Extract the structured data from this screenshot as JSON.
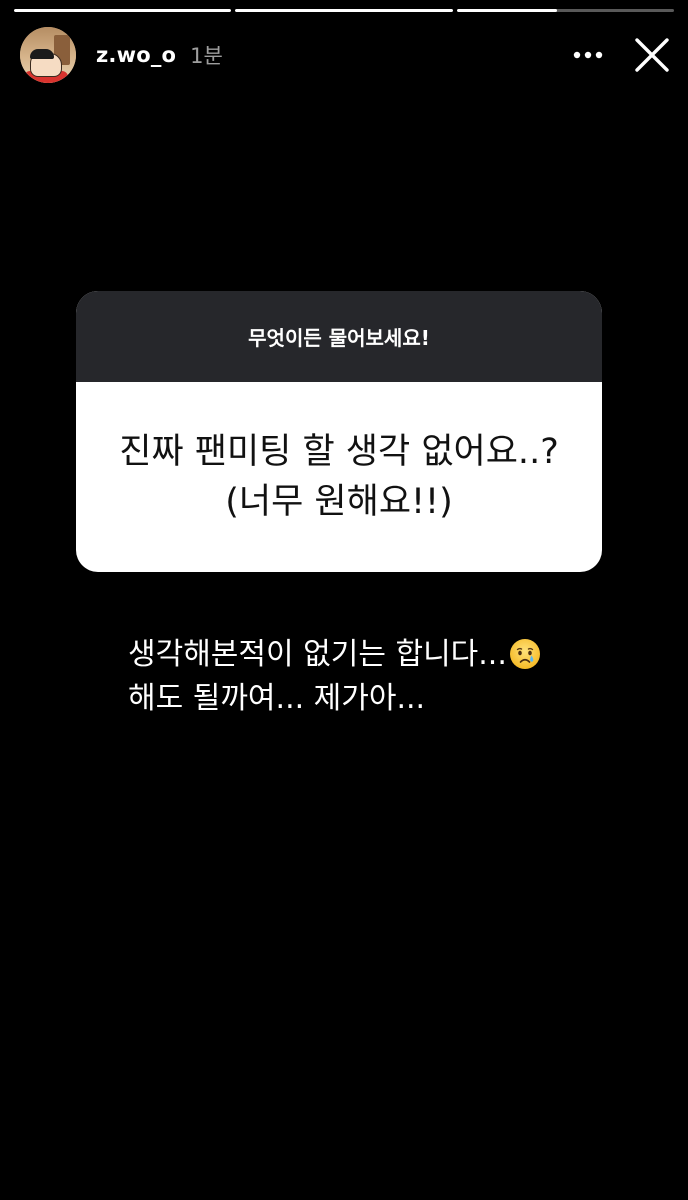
{
  "story": {
    "progress": [
      1.0,
      1.0,
      0.46
    ]
  },
  "header": {
    "username": "z.wo_o",
    "timestamp": "1분",
    "avatar_icon": "avatar-icon",
    "more_icon": "more-horizontal-icon",
    "close_icon": "close-icon"
  },
  "question_sticker": {
    "prompt": "무엇이든 물어보세요!",
    "question_line1": "진짜 팬미팅 할 생각 없어요..?",
    "question_line2": "(너무 원해요!!)"
  },
  "answer": {
    "line1": "생각해본적이 없기는 합니다...",
    "line2": "해도 될까여... 제가아...",
    "emoji": "crying-face-icon"
  },
  "colors": {
    "background": "#000000",
    "sticker_header": "#26272b",
    "sticker_body": "#ffffff",
    "text_primary": "#ffffff"
  }
}
